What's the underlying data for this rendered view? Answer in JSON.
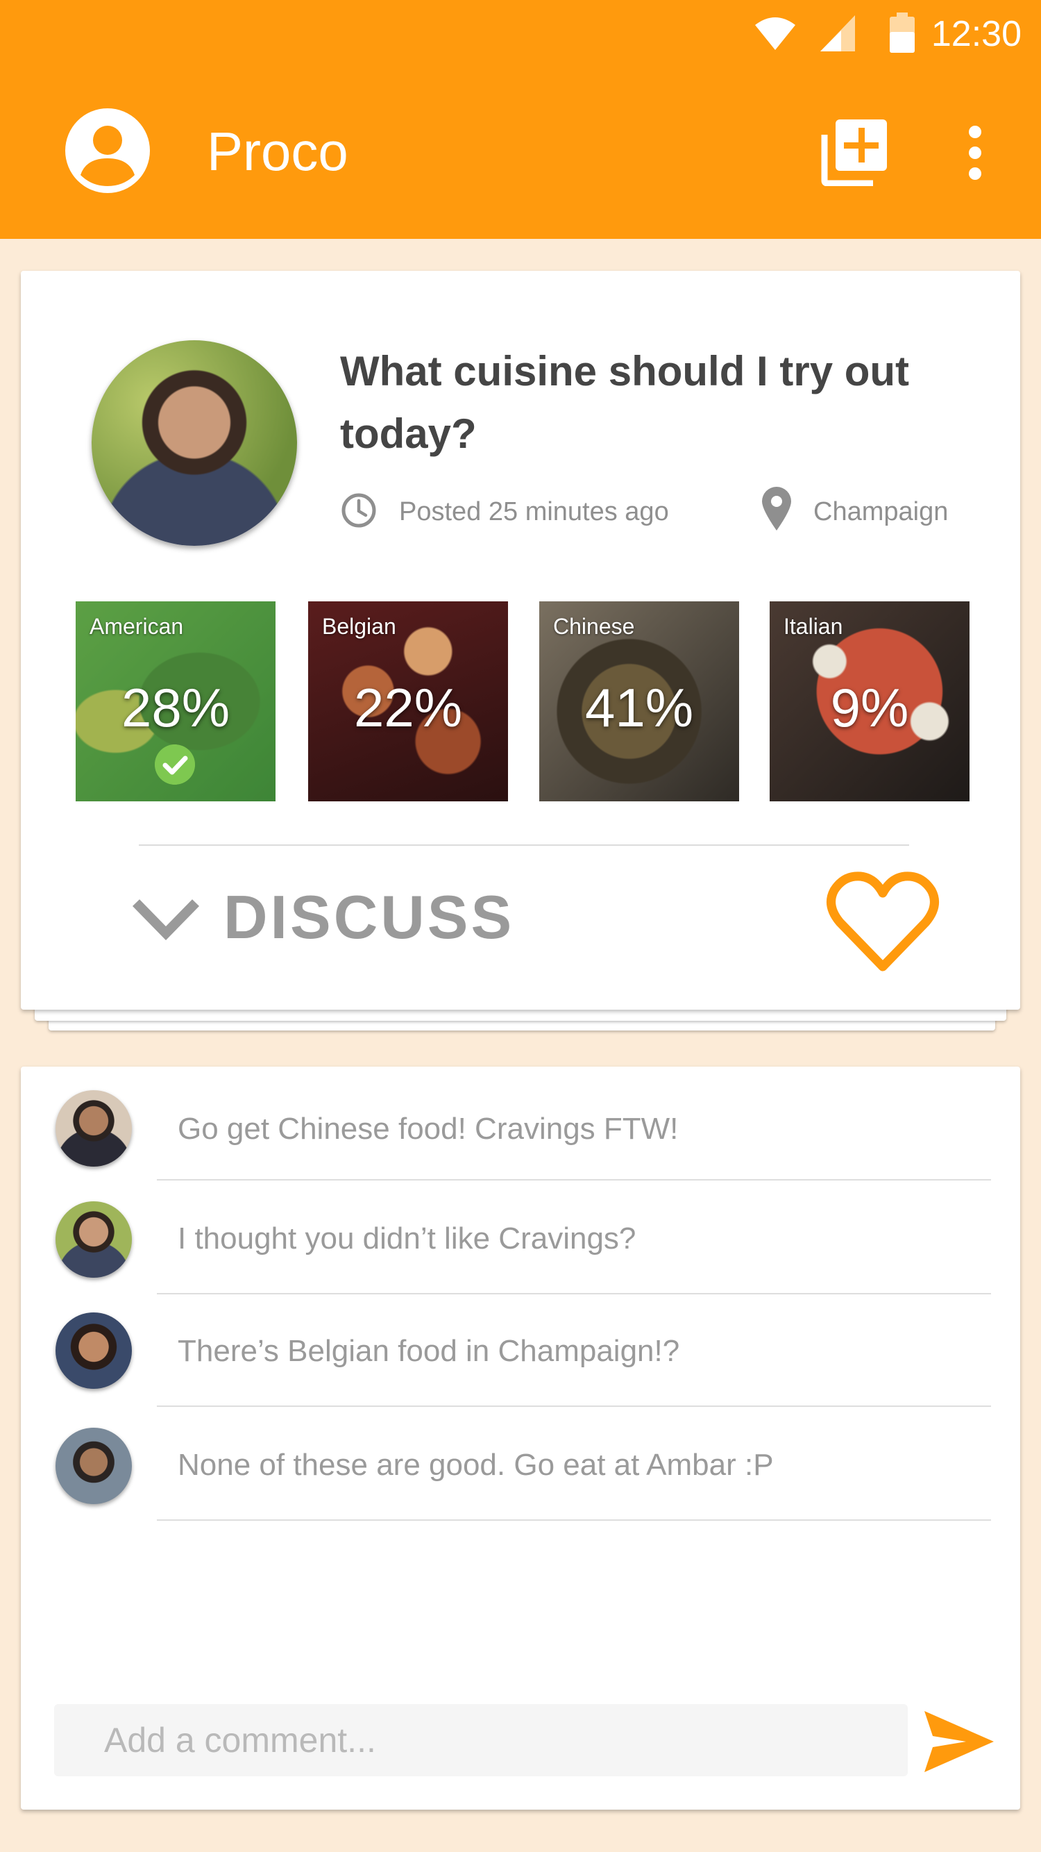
{
  "status_bar": {
    "time": "12:30",
    "icons": [
      "wifi-icon",
      "cell-signal-icon",
      "battery-icon"
    ]
  },
  "app_bar": {
    "title": "Proco",
    "icons": [
      "account-icon",
      "add-poll-icon",
      "more-vert-icon"
    ],
    "color": "#ff9a0d"
  },
  "post": {
    "question": "What cuisine should I try out today?",
    "posted": "Posted 25 minutes ago",
    "location": "Champaign",
    "options": [
      {
        "label": "American",
        "percent": "28%",
        "selected": true
      },
      {
        "label": "Belgian",
        "percent": "22%",
        "selected": false
      },
      {
        "label": "Chinese",
        "percent": "41%",
        "selected": false
      },
      {
        "label": "Italian",
        "percent": "9%",
        "selected": false
      }
    ],
    "discuss_label": "DISCUSS",
    "accent_color": "#ff9a0d"
  },
  "comments": [
    {
      "text": "Go get Chinese food! Cravings FTW!"
    },
    {
      "text": "I thought you didn’t like Cravings?"
    },
    {
      "text": "There’s Belgian food in Champaign!?"
    },
    {
      "text": "None of these are good. Go eat at Ambar :P"
    }
  ],
  "composer": {
    "placeholder": "Add a comment...",
    "value": ""
  }
}
